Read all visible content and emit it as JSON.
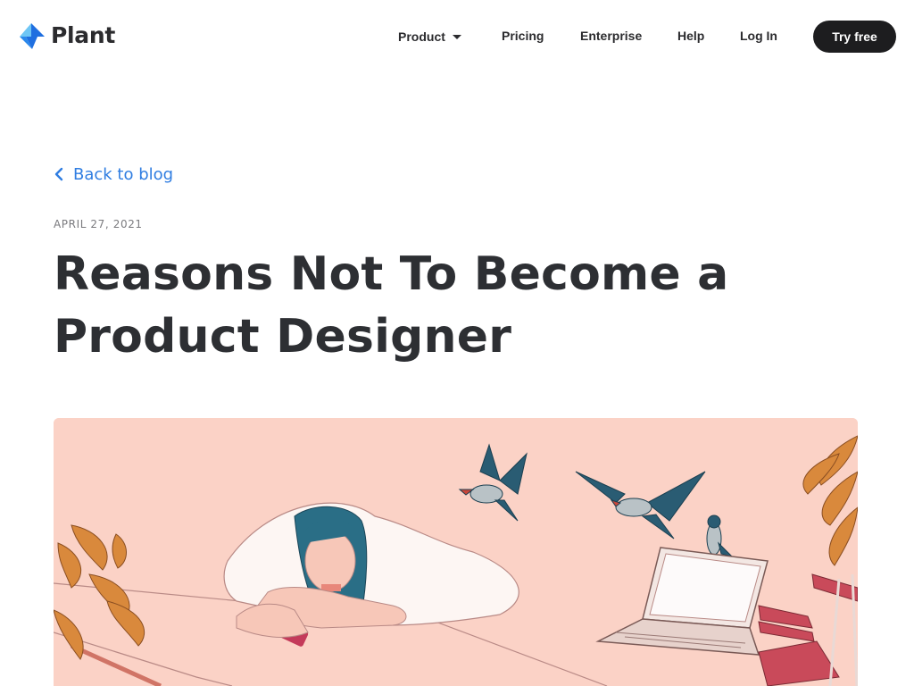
{
  "header": {
    "brand": "Plant",
    "nav": {
      "product": "Product",
      "pricing": "Pricing",
      "enterprise": "Enterprise",
      "help": "Help",
      "login": "Log In"
    },
    "cta": "Try free"
  },
  "post": {
    "back_label": "Back to blog",
    "date": "APRIL 27, 2021",
    "title_line1": "Reasons Not To Become a",
    "title_line2": "Product Designer"
  },
  "colors": {
    "accent": "#2f7de1",
    "logo_light_blue": "#6ec6f5",
    "logo_blue": "#1f6fe0",
    "dark_button": "#1d1d1f",
    "hero_background": "#fbd2c6"
  },
  "icons": {
    "logo": "plant-logo-icon",
    "caret": "chevron-down-icon",
    "back": "chevron-left-icon"
  }
}
